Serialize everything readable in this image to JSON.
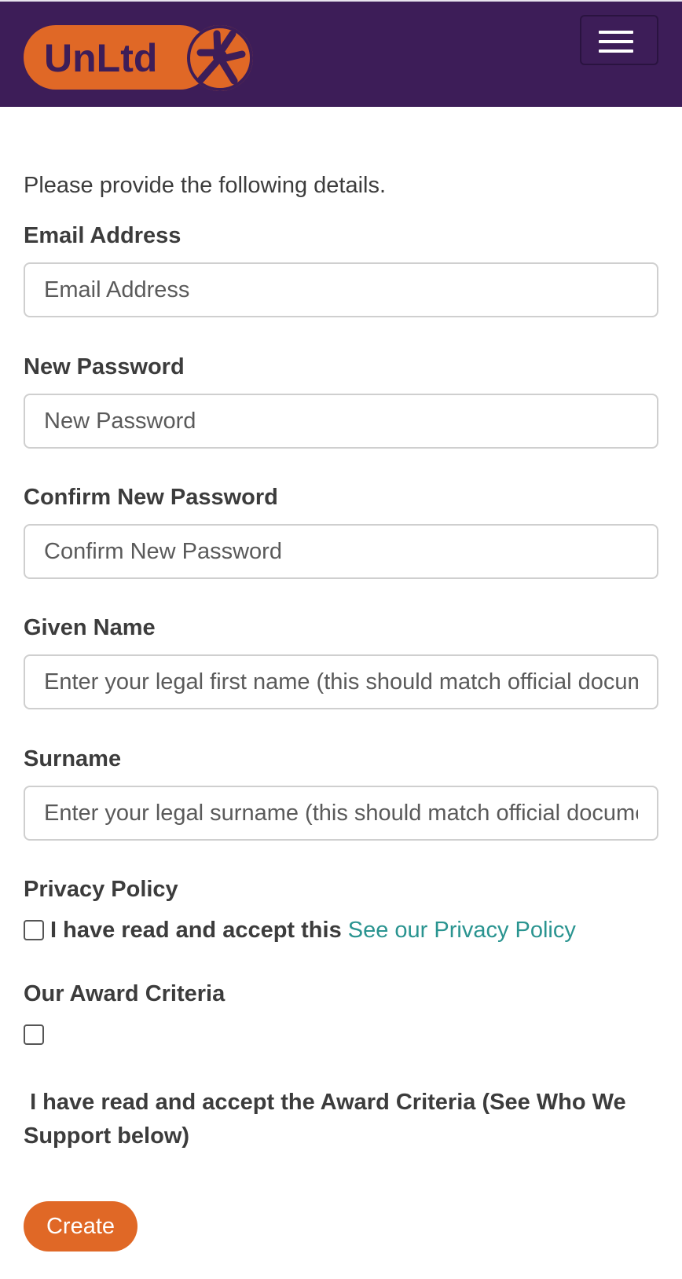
{
  "header": {
    "logo_text": "UnLtd",
    "logo_bg_color": "#e06826",
    "logo_text_color": "#3d1d58",
    "nav_bg_color": "#3d1d58",
    "menu_icon": "hamburger-menu-icon"
  },
  "form": {
    "intro": "Please provide the following details.",
    "email": {
      "label": "Email Address",
      "placeholder": "Email Address",
      "value": ""
    },
    "new_password": {
      "label": "New Password",
      "placeholder": "New Password",
      "value": ""
    },
    "confirm_password": {
      "label": "Confirm New Password",
      "placeholder": "Confirm New Password",
      "value": ""
    },
    "given_name": {
      "label": "Given Name",
      "placeholder": "Enter your legal first name (this should match official documents)",
      "value": ""
    },
    "surname": {
      "label": "Surname",
      "placeholder": "Enter your legal surname (this should match official documents)",
      "value": ""
    },
    "privacy": {
      "heading": "Privacy Policy",
      "checkbox_text": "I have read and accept this",
      "link_text": "See our Privacy Policy",
      "checked": false
    },
    "award": {
      "heading": "Our Award Criteria",
      "checkbox_text": "I have read and accept the Award Criteria (See Who We Support below)",
      "checked": false
    },
    "submit_label": "Create",
    "accent_color": "#e06826",
    "link_color": "#2a9490"
  }
}
